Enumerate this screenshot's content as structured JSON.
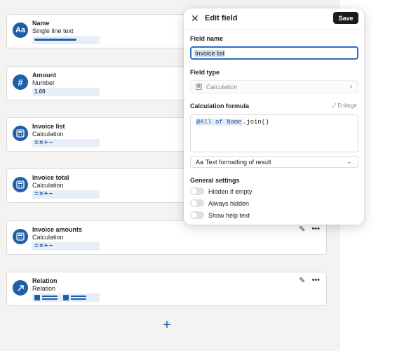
{
  "fields": [
    {
      "name": "Name",
      "type": "Single line text",
      "icon": "Aa",
      "preview": "bar"
    },
    {
      "name": "Amount",
      "type": "Number",
      "icon": "#",
      "preview": "number",
      "preview_value": "1.00"
    },
    {
      "name": "Invoice list",
      "type": "Calculation",
      "icon": "calculator",
      "preview": "ops",
      "preview_value": "=×+−"
    },
    {
      "name": "Invoice total",
      "type": "Calculation",
      "icon": "calculator",
      "preview": "ops",
      "preview_value": "=×+−"
    },
    {
      "name": "Invoice amounts",
      "type": "Calculation",
      "icon": "calculator",
      "preview": "ops",
      "preview_value": "=×+−"
    },
    {
      "name": "Relation",
      "type": "Relation",
      "icon": "arrow-up-right",
      "preview": "relation"
    }
  ],
  "modal": {
    "title": "Edit field",
    "save_label": "Save",
    "field_name_label": "Field name",
    "field_name_value": "Invoice list",
    "field_type_label": "Field type",
    "field_type_value": "Calculation",
    "formula_label": "Calculation formula",
    "enlarge_label": "Enlarge",
    "formula_token": "@All of Name",
    "formula_rest": ".join()",
    "format_label": "Text formatting of result",
    "format_prefix": "Aa",
    "general_label": "General settings",
    "toggles": [
      "Hidden if empty",
      "Always hidden",
      "Show help text"
    ]
  },
  "colors": {
    "accent": "#1f5ea8",
    "background": "#f4f3f1"
  }
}
